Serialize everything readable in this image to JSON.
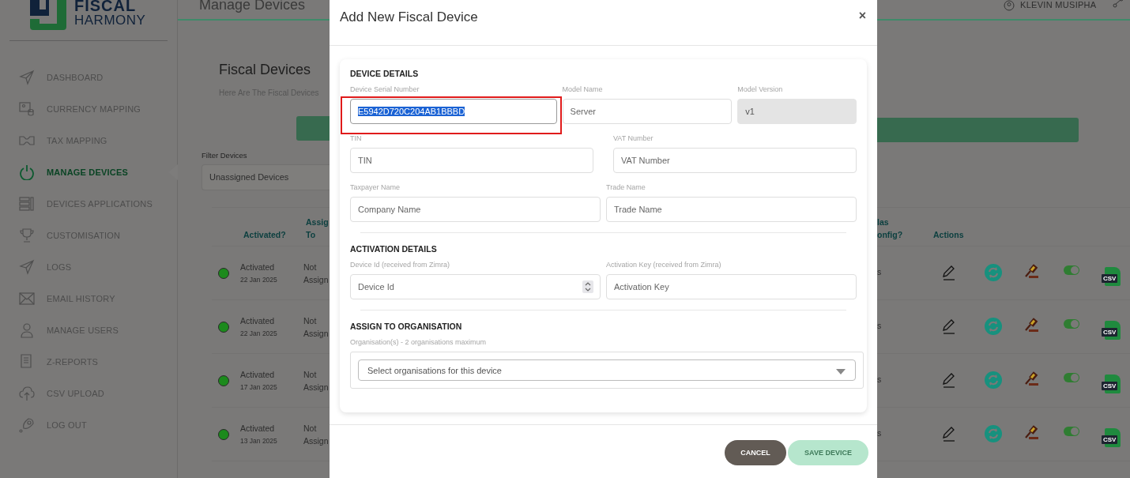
{
  "sidebar": {
    "brand": {
      "top": "FISCAL",
      "bottom": "HARMONY"
    },
    "items": [
      {
        "label": "DASHBOARD",
        "selected": false
      },
      {
        "label": "CURRENCY MAPPING",
        "selected": false
      },
      {
        "label": "TAX MAPPING",
        "selected": false
      },
      {
        "label": "MANAGE DEVICES",
        "selected": true
      },
      {
        "label": "DEVICES APPLICATIONS",
        "selected": false
      },
      {
        "label": "CUSTOMISATION",
        "selected": false
      },
      {
        "label": "LOGS",
        "selected": false
      },
      {
        "label": "EMAIL HISTORY",
        "selected": false
      },
      {
        "label": "MANAGE USERS",
        "selected": false
      },
      {
        "label": "Z-REPORTS",
        "selected": false
      },
      {
        "label": "CSV UPLOAD",
        "selected": false
      },
      {
        "label": "LOG OUT",
        "selected": false
      }
    ]
  },
  "header": {
    "title": "Manage Devices",
    "user": "KLEVIN MUSIPHA"
  },
  "page": {
    "title": "Fiscal Devices",
    "subtitle": "Here Are The Fiscal Devices",
    "filter": {
      "label": "Filter Devices",
      "value": "Unassigned Devices"
    }
  },
  "table": {
    "columns": [
      "Activated?",
      "Assig To",
      "las onfig?",
      "Actions"
    ],
    "rows": [
      {
        "status": "Activated",
        "date": "22 Jan 2025",
        "assigned": "Not Assign",
        "config": "s",
        "color": "#1c8a1c",
        "on": true,
        "file_label": "CSV"
      },
      {
        "status": "Activated",
        "date": "22 Jan 2025",
        "assigned": "Not Assign",
        "config": "s",
        "color": "#1c8a1c",
        "on": true,
        "file_label": "CSV"
      },
      {
        "status": "Activated",
        "date": "17 Jan 2025",
        "assigned": "Not Assign",
        "config": "s",
        "color": "#1c8a1c",
        "on": true,
        "file_label": "CSV"
      },
      {
        "status": "Activated",
        "date": "13 Jan 2025",
        "assigned": "Not Assign",
        "config": "s",
        "color": "#1c8a1c",
        "on": true,
        "file_label": "CSV"
      }
    ]
  },
  "modal": {
    "title": "Add New Fiscal Device",
    "close": "×",
    "sections": [
      {
        "title": "DEVICE DETAILS",
        "rows": [
          [
            {
              "label": "Device Serial Number",
              "kind": "text",
              "value": "E5942D720C204AB1BBBD",
              "selected": true,
              "flagged": true
            },
            {
              "label": "Model Name",
              "kind": "text",
              "value": "Server"
            },
            {
              "label": "Model Version",
              "kind": "text",
              "value": "v1",
              "disabled": true
            }
          ],
          [
            {
              "label": "TIN",
              "kind": "text",
              "placeholder": "TIN"
            },
            {
              "label": "VAT Number",
              "kind": "text",
              "placeholder": "VAT Number"
            }
          ],
          [
            {
              "label": "Taxpayer Name",
              "kind": "text",
              "placeholder": "Company Name"
            },
            {
              "label": "Trade Name",
              "kind": "text",
              "placeholder": "Trade Name"
            }
          ]
        ]
      },
      {
        "title": "ACTIVATION DETAILS",
        "rows": [
          [
            {
              "label": "Device Id (received from Zimra)",
              "kind": "number",
              "placeholder": "Device Id"
            },
            {
              "label": "Activation Key (received from Zimra)",
              "kind": "text",
              "placeholder": "Activation Key"
            }
          ]
        ]
      },
      {
        "title": "ASSIGN TO ORGANISATION",
        "rows": [
          [
            {
              "label": "Organisation(s) - 2 organisations maximum",
              "kind": "select",
              "placeholder": "Select organisations for this device"
            }
          ]
        ]
      }
    ],
    "buttons": [
      {
        "label": "CANCEL",
        "kind": "secondary"
      },
      {
        "label": "SAVE DEVICE",
        "kind": "primary",
        "disabled": true
      }
    ]
  }
}
